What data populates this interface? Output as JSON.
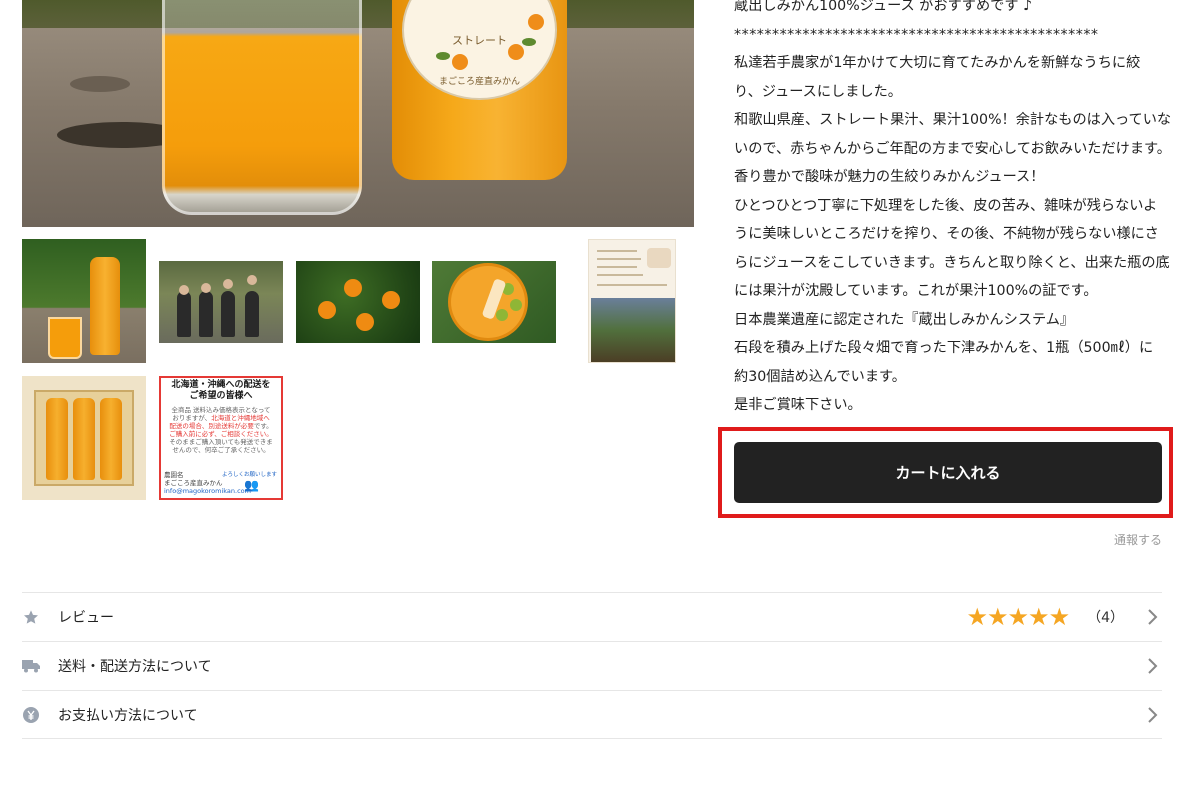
{
  "product": {
    "main_photo": {
      "bottle_label_line1": "ストレート",
      "bottle_label_line2": "まごころ産直みかん"
    },
    "thumbnails": {
      "notice": {
        "title_line1": "北海道・沖縄への配送を",
        "title_line2": "ご希望の皆様へ",
        "body_line1": "全商品 送料込み価格表示となって",
        "body_line2": "おりますが、",
        "body_red1": "北海道と沖縄地域へ",
        "body_red2": "配送の場合、別途送料が必要",
        "body_line3": "です。",
        "body_red3": "ご購入前に必ず、ご相談ください。",
        "body_line4": "そのままご購入頂いても発送できま",
        "body_line5": "せんので、何卒ご了承ください。",
        "closing": "よろしくお願いします",
        "shop_label": "農園名",
        "shop_name": "まごころ産直みかん",
        "email": "info@magokoromikan.com"
      }
    }
  },
  "description": {
    "lines": [
      "蔵出しみかん100%ジュース がおすすめです ♪",
      "************************************************",
      "私達若手農家が1年かけて大切に育てたみかんを新鮮なうちに絞",
      "り、ジュースにしました。",
      "和歌山県産、ストレート果汁、果汁100%！余計なものは入っていな",
      "いので、赤ちゃんからご年配の方まで安心してお飲みいただけます。",
      "香り豊かで酸味が魅力の生絞りみかんジュース！",
      "ひとつひとつ丁寧に下処理をした後、皮の苦み、雑味が残らないよ",
      "うに美味しいところだけを搾り、その後、不純物が残らない様にさ",
      "らにジュースをこしていきます。きちんと取り除くと、出来た瓶の底",
      "には果汁が沈殿しています。これが果汁100%の証です。",
      "日本農業遺産に認定された『蔵出しみかんシステム』",
      "石段を積み上げた段々畑で育った下津みかんを、1瓶（500㎖）に",
      "約30個詰め込んでいます。",
      "是非ご賞味下さい。"
    ]
  },
  "cart": {
    "button_label": "カートに入れる",
    "report_label": "通報する"
  },
  "info_rows": {
    "review": {
      "label": "レビュー",
      "rating": 5,
      "stars": "★★★★★",
      "count": "（4）",
      "icon": "star-icon"
    },
    "shipping": {
      "label": "送料・配送方法について",
      "icon": "truck-icon"
    },
    "payment": {
      "label": "お支払い方法について",
      "icon": "yen-icon"
    }
  },
  "colors": {
    "cart_button_bg": "#222222",
    "highlight_border": "#e01b1b",
    "star_color": "#f5a623",
    "icon_gray": "#9aa3b0"
  }
}
